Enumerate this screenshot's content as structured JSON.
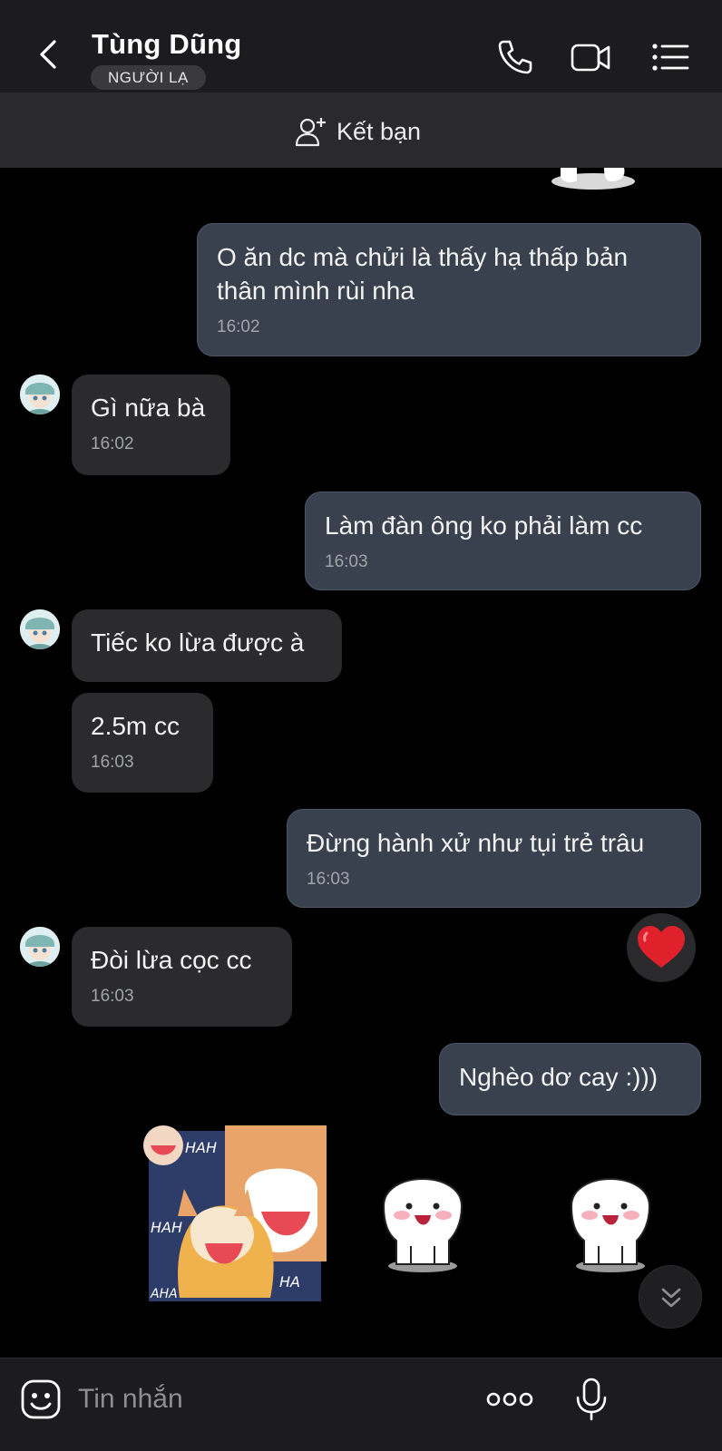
{
  "header": {
    "title": "Tùng Dũng",
    "badge": "NGƯỜI LẠ",
    "icons": [
      "back-icon",
      "phone-icon",
      "video-icon",
      "list-menu-icon"
    ]
  },
  "add_friend": {
    "label": "Kết bạn",
    "icon": "add-person-icon"
  },
  "messages": [
    {
      "direction": "out",
      "text": "O ăn dc mà chửi là thấy hạ thấp bản thân mình rùi nha",
      "time": "16:02"
    },
    {
      "direction": "in",
      "text": "Gì nữa bà",
      "time": "16:02"
    },
    {
      "direction": "out",
      "text": "Làm đàn ông ko phải làm cc",
      "time": "16:03"
    },
    {
      "direction": "in",
      "text": "Tiếc ko lừa được à",
      "time": ""
    },
    {
      "direction": "in",
      "text": "2.5m cc",
      "time": "16:03"
    },
    {
      "direction": "out",
      "text": "Đừng hành xử như tụi trẻ trâu",
      "time": "16:03"
    },
    {
      "direction": "in",
      "text": "Đòi lừa cọc cc",
      "time": "16:03"
    },
    {
      "direction": "out",
      "text": "Nghèo dơ cay :)))",
      "time": ""
    }
  ],
  "reaction": {
    "icon": "heart-icon",
    "color": "#e0202a"
  },
  "stickers": [
    "laughing-dogs-sticker",
    "white-blob-sticker",
    "white-blob-sticker"
  ],
  "input": {
    "placeholder": "Tin nhắn"
  },
  "colors": {
    "outgoing_bubble": "#39414f",
    "incoming_bubble": "#2b2b2d",
    "background": "#000000"
  }
}
